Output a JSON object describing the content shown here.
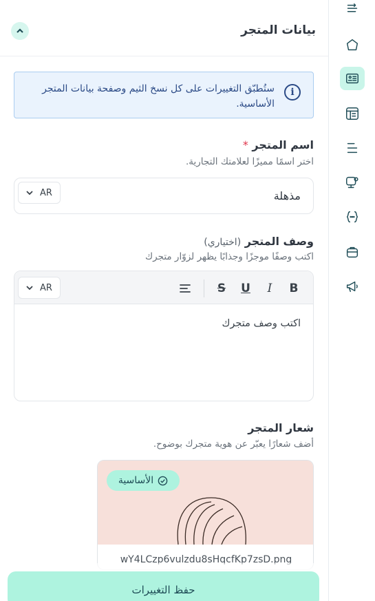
{
  "panel": {
    "title": "بيانات المتجر"
  },
  "notice": {
    "icon": "info-icon",
    "text": "ستُطبّق التغييرات على كل نسخ الثيم وصفحة بيانات المتجر الأساسية."
  },
  "store_name": {
    "label": "اسم المتجر",
    "required_mark": "*",
    "hint": "اختر اسمًا مميزًا لعلامتك التجارية.",
    "value": "مذهلة",
    "lang": "AR"
  },
  "store_description": {
    "label": "وصف المتجر",
    "optional": "(اختياري)",
    "hint": "اكتب وصفًا موجزًا وجذابًا يظهر لزوّار متجرك",
    "placeholder": "اكتب وصف متجرك",
    "lang": "AR",
    "toolbar": {
      "bold": "B",
      "italic": "I",
      "underline": "U",
      "strike": "S"
    }
  },
  "store_logo": {
    "label": "شعار المتجر",
    "hint": "أضف شعارًا يعبّر عن هوية متجرك بوضوح.",
    "badge": "الأساسية",
    "file_name": "wY4LCzp6vulzdu8sHqcfKp7zsD.png"
  },
  "actions": {
    "save_label": "حفظ التغييرات"
  },
  "rail_icons": [
    "list-icon",
    "home-icon",
    "store-info-icon",
    "layout-icon",
    "menu-icon",
    "settings-icon",
    "code-icon",
    "box-icon",
    "megaphone-icon"
  ],
  "colors": {
    "accent": "#aef3df",
    "active_rail": "#c9f5e9",
    "notice_bg": "#eaf3fd",
    "notice_border": "#a9ccf0",
    "required": "#e0354b"
  }
}
